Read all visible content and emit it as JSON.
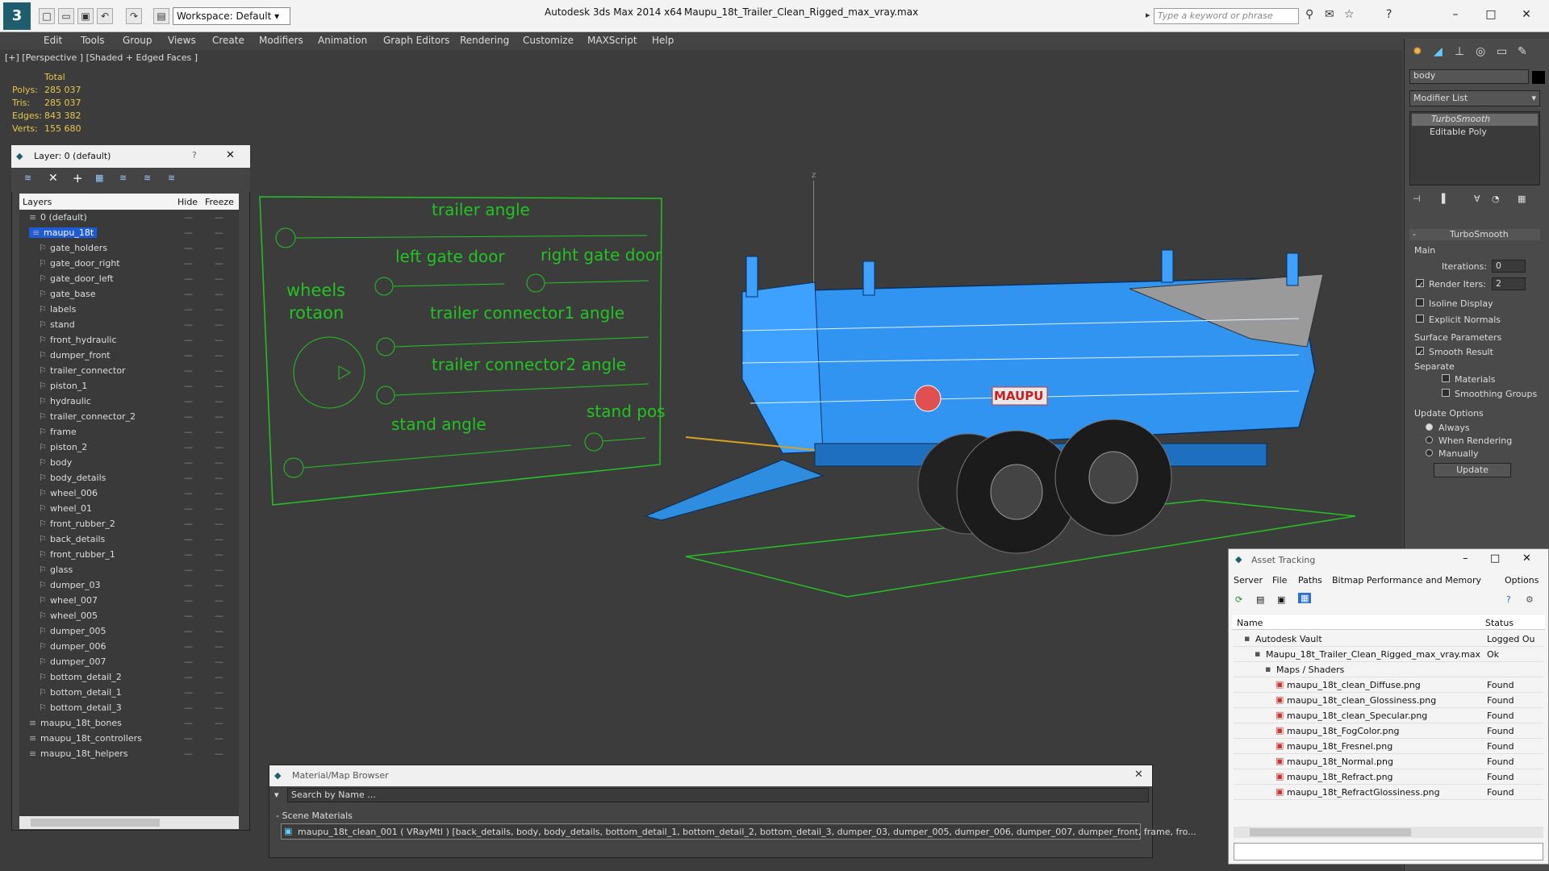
{
  "titlebar": {
    "workspace": "Workspace: Default",
    "app_title": "Autodesk 3ds Max  2014 x64",
    "file_title": "Maupu_18t_Trailer_Clean_Rigged_max_vray.max",
    "search_placeholder": "Type a keyword or phrase"
  },
  "menu": [
    "Edit",
    "Tools",
    "Group",
    "Views",
    "Create",
    "Modifiers",
    "Animation",
    "Graph Editors",
    "Rendering",
    "Customize",
    "MAXScript",
    "Help"
  ],
  "viewport": {
    "label": "[+] [Perspective ] [Shaded + Edged Faces ]",
    "stats_header": "Total",
    "stats": [
      {
        "label": "Polys:",
        "value": "285 037"
      },
      {
        "label": "Tris:",
        "value": "285 037"
      },
      {
        "label": "Edges:",
        "value": "843 382"
      },
      {
        "label": "Verts:",
        "value": "155 680"
      }
    ],
    "rig_labels": {
      "trailer_angle": "trailer angle",
      "left_gate_door": "left gate door",
      "right_gate_door": "right gate door",
      "wheels_rotation_1": "wheels",
      "wheels_rotation_2": "rotaon",
      "trailer_connector1": "trailer connector1 angle",
      "trailer_connector2": "trailer connector2 angle",
      "stand_angle": "stand angle",
      "stand_pos": "stand pos"
    },
    "logo_text": "MAUPU",
    "axis_label": "z",
    "wire_color": "#2aa0ff",
    "helper_color": "#22c322"
  },
  "layer_panel": {
    "title": "Layer: 0 (default)",
    "help": "?",
    "col_layers": "Layers",
    "col_hide": "Hide",
    "col_freeze": "Freeze",
    "layers": [
      {
        "name": "0 (default)",
        "level": 0
      },
      {
        "name": "maupu_18t",
        "level": 0,
        "selected": true
      },
      {
        "name": "gate_holders",
        "level": 1
      },
      {
        "name": "gate_door_right",
        "level": 1
      },
      {
        "name": "gate_door_left",
        "level": 1
      },
      {
        "name": "gate_base",
        "level": 1
      },
      {
        "name": "labels",
        "level": 1
      },
      {
        "name": "stand",
        "level": 1
      },
      {
        "name": "front_hydraulic",
        "level": 1
      },
      {
        "name": "dumper_front",
        "level": 1
      },
      {
        "name": "trailer_connector",
        "level": 1
      },
      {
        "name": "piston_1",
        "level": 1
      },
      {
        "name": "hydraulic",
        "level": 1
      },
      {
        "name": "trailer_connector_2",
        "level": 1
      },
      {
        "name": "frame",
        "level": 1
      },
      {
        "name": "piston_2",
        "level": 1
      },
      {
        "name": "body",
        "level": 1
      },
      {
        "name": "body_details",
        "level": 1
      },
      {
        "name": "wheel_006",
        "level": 1
      },
      {
        "name": "wheel_01",
        "level": 1
      },
      {
        "name": "front_rubber_2",
        "level": 1
      },
      {
        "name": "back_details",
        "level": 1
      },
      {
        "name": "front_rubber_1",
        "level": 1
      },
      {
        "name": "glass",
        "level": 1
      },
      {
        "name": "dumper_03",
        "level": 1
      },
      {
        "name": "wheel_007",
        "level": 1
      },
      {
        "name": "wheel_005",
        "level": 1
      },
      {
        "name": "dumper_005",
        "level": 1
      },
      {
        "name": "dumper_006",
        "level": 1
      },
      {
        "name": "dumper_007",
        "level": 1
      },
      {
        "name": "bottom_detail_2",
        "level": 1
      },
      {
        "name": "bottom_detail_1",
        "level": 1
      },
      {
        "name": "bottom_detail_3",
        "level": 1
      },
      {
        "name": "maupu_18t_bones",
        "level": 0
      },
      {
        "name": "maupu_18t_controllers",
        "level": 0
      },
      {
        "name": "maupu_18t_helpers",
        "level": 0
      }
    ]
  },
  "command_panel": {
    "object_name": "body",
    "modifier_list": "Modifier List",
    "stack": [
      "TurboSmooth",
      "Editable Poly"
    ],
    "rollout_title": "TurboSmooth",
    "main": "Main",
    "iterations_label": "Iterations:",
    "iterations_value": "0",
    "render_iters_label": "Render Iters:",
    "render_iters_value": "2",
    "isoline": "Isoline Display",
    "explicit_normals": "Explicit Normals",
    "surface_params": "Surface Parameters",
    "smooth_result": "Smooth Result",
    "separate": "Separate",
    "materials": "Materials",
    "smoothing_groups": "Smoothing Groups",
    "update_options": "Update Options",
    "always": "Always",
    "when_rendering": "When Rendering",
    "manually": "Manually",
    "update_btn": "Update"
  },
  "asset_tracking": {
    "title": "Asset Tracking",
    "menu": [
      "Server",
      "File",
      "Paths",
      "Bitmap Performance and Memory",
      "Options"
    ],
    "col_name": "Name",
    "col_status": "Status",
    "rows": [
      {
        "name": "Autodesk Vault",
        "status": "Logged Ou",
        "indent": 1
      },
      {
        "name": "Maupu_18t_Trailer_Clean_Rigged_max_vray.max",
        "status": "Ok",
        "indent": 2
      },
      {
        "name": "Maps / Shaders",
        "status": "",
        "indent": 3
      },
      {
        "name": "maupu_18t_clean_Diffuse.png",
        "status": "Found",
        "indent": 4
      },
      {
        "name": "maupu_18t_clean_Glossiness.png",
        "status": "Found",
        "indent": 4
      },
      {
        "name": "maupu_18t_clean_Specular.png",
        "status": "Found",
        "indent": 4
      },
      {
        "name": "maupu_18t_FogColor.png",
        "status": "Found",
        "indent": 4
      },
      {
        "name": "maupu_18t_Fresnel.png",
        "status": "Found",
        "indent": 4
      },
      {
        "name": "maupu_18t_Normal.png",
        "status": "Found",
        "indent": 4
      },
      {
        "name": "maupu_18t_Refract.png",
        "status": "Found",
        "indent": 4
      },
      {
        "name": "maupu_18t_RefractGlossiness.png",
        "status": "Found",
        "indent": 4
      }
    ]
  },
  "material_browser": {
    "title": "Material/Map Browser",
    "search_placeholder": "Search by Name ...",
    "section": "- Scene Materials",
    "material": "maupu_18t_clean_001 ( VRayMtl ) [back_details, body, body_details, bottom_detail_1, bottom_detail_2, bottom_detail_3, dumper_03, dumper_005, dumper_006, dumper_007, dumper_front, frame, fro..."
  }
}
